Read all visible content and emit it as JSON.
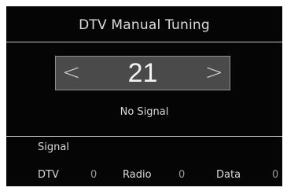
{
  "header": {
    "title": "DTV Manual Tuning"
  },
  "tuner": {
    "channel": "21",
    "prev_symbol": "<",
    "next_symbol": ">",
    "status": "No Signal"
  },
  "signal": {
    "label": "Signal"
  },
  "counts": {
    "dtv_label": "DTV",
    "dtv_value": "0",
    "radio_label": "Radio",
    "radio_value": "0",
    "data_label": "Data",
    "data_value": "0"
  },
  "colors": {
    "background": "#050505",
    "selector": "#4a4a4a",
    "text": "#e6e6e6"
  }
}
